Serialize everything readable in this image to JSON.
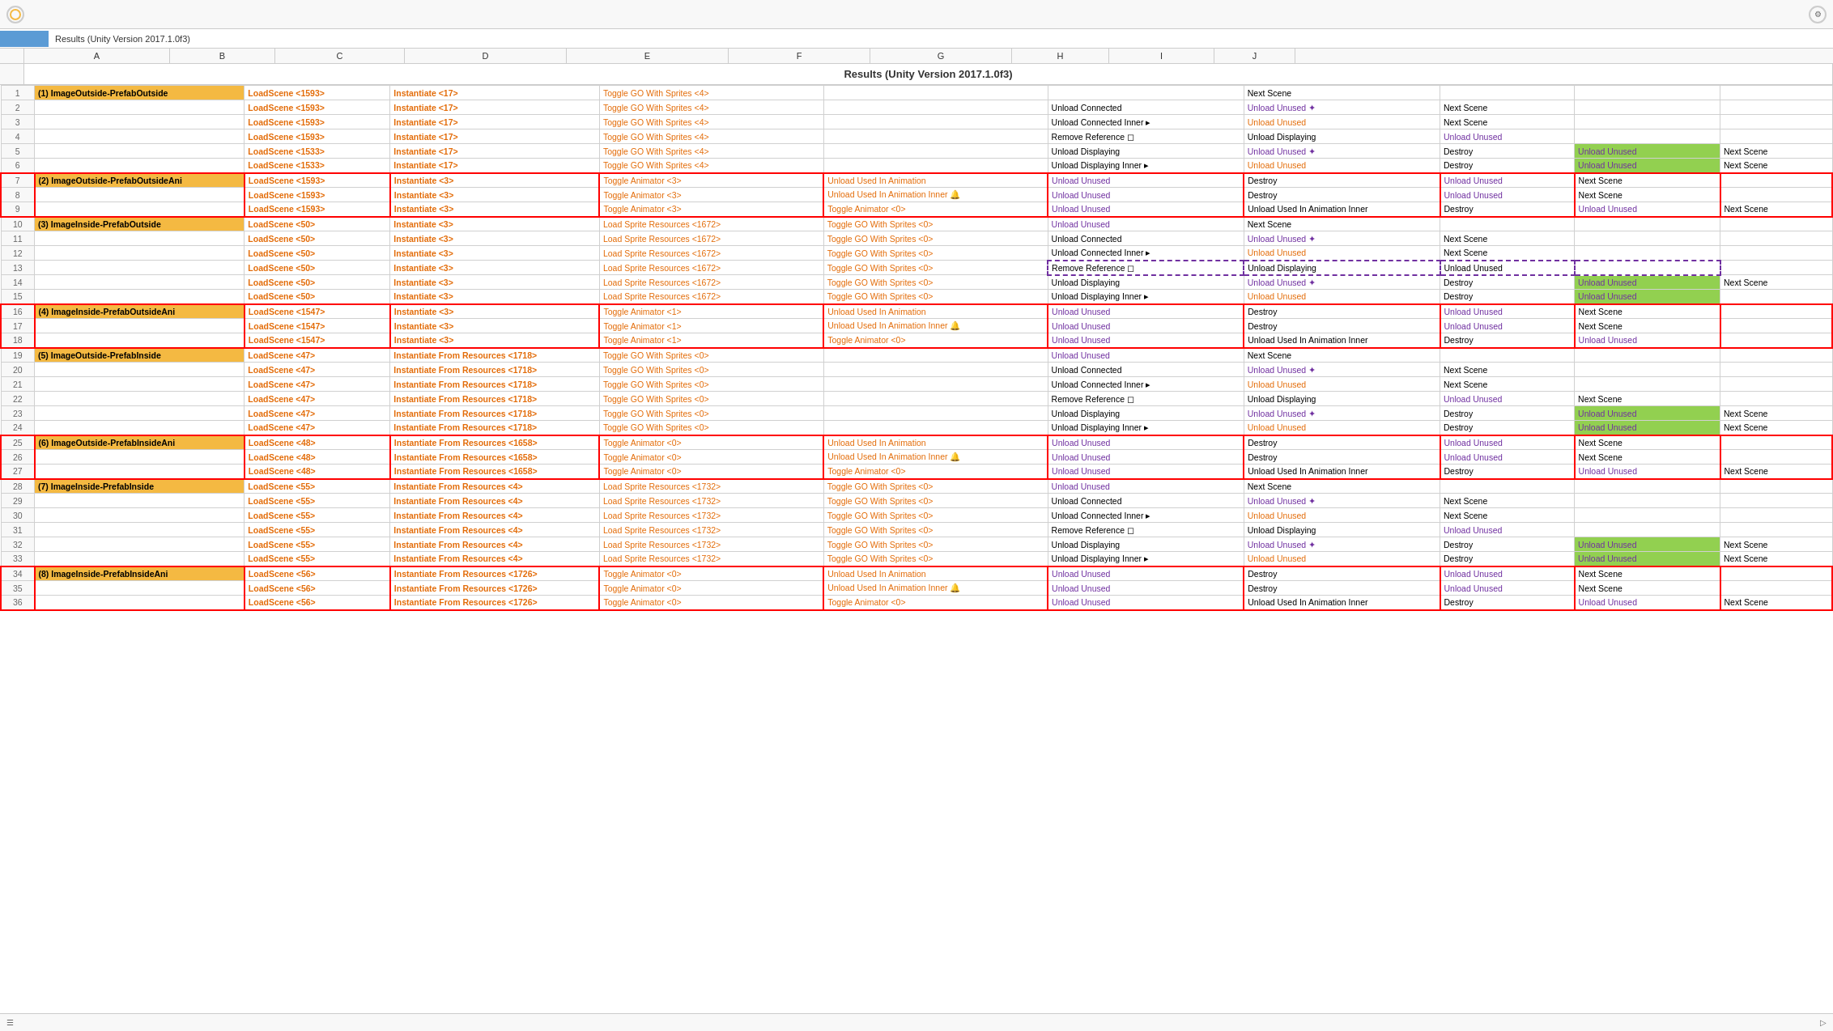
{
  "app": {
    "title": "Results (Unity Version 2017.1.0f3)"
  },
  "columns": {
    "headers": [
      "",
      "A",
      "B",
      "C",
      "D",
      "E",
      "F",
      "G",
      "H",
      "I",
      "J"
    ],
    "widths": [
      30,
      180,
      130,
      160,
      200,
      200,
      175,
      175,
      120,
      130,
      100
    ]
  },
  "rows": [
    {
      "num": "1",
      "a": "(1) ImageOutside-PrefabOutside",
      "b": "LoadScene <1593>",
      "c": "Instantiate <17>",
      "d": "Toggle GO With Sprites <4>",
      "e": "",
      "f": "",
      "g": "Next Scene",
      "h": "",
      "i": "",
      "j": "",
      "a_class": "orange-bg section-header"
    },
    {
      "num": "2",
      "a": "",
      "b": "LoadScene <1593>",
      "c": "Instantiate <17>",
      "d": "Toggle GO With Sprites <4>",
      "e": "",
      "f": "Unload Connected",
      "g": "Unload Unused ✦",
      "h": "Next Scene",
      "i": "",
      "j": "",
      "g_class": "purple-text"
    },
    {
      "num": "3",
      "a": "",
      "b": "LoadScene <1593>",
      "c": "Instantiate <17>",
      "d": "Toggle GO With Sprites <4>",
      "e": "",
      "f": "Unload Connected Inner ▸",
      "g": "Unload Unused",
      "h": "Next Scene",
      "i": "",
      "j": "",
      "g_class": "orange-text"
    },
    {
      "num": "4",
      "a": "",
      "b": "LoadScene <1593>",
      "c": "Instantiate <17>",
      "d": "Toggle GO With Sprites <4>",
      "e": "",
      "f": "Remove Reference ◻",
      "g": "Unload Displaying",
      "h": "Unload Unused",
      "i": "",
      "j": "",
      "h_class": "purple-text"
    },
    {
      "num": "5",
      "a": "",
      "b": "LoadScene <1533>",
      "c": "Instantiate <17>",
      "d": "Toggle GO With Sprites <4>",
      "e": "",
      "f": "Unload Displaying",
      "g": "Unload Unused ✦",
      "h": "Destroy",
      "i": "Unload Unused",
      "j": "Next Scene",
      "g_class": "purple-text",
      "i_class": "green-bg purple-text"
    },
    {
      "num": "6",
      "a": "",
      "b": "LoadScene <1533>",
      "c": "Instantiate <17>",
      "d": "Toggle GO With Sprites <4>",
      "e": "",
      "f": "Unload Displaying Inner ▸",
      "g": "Unload Unused",
      "h": "Destroy",
      "i": "Unload Unused",
      "j": "Next Scene",
      "g_class": "orange-text",
      "i_class": "green-bg purple-text"
    },
    {
      "num": "7",
      "a": "(2) ImageOutside-PrefabOutsideAni",
      "b": "LoadScene <1593>",
      "c": "Instantiate <3>",
      "d": "Toggle Animator <3>",
      "e": "Unload Used In Animation",
      "f": "Unload Unused",
      "g": "Destroy",
      "h": "Unload Unused",
      "i": "Next Scene",
      "j": "",
      "a_class": "orange-bg section-header",
      "f_class": "purple-text",
      "h_class": "purple-text",
      "red_border": true
    },
    {
      "num": "8",
      "a": "",
      "b": "LoadScene <1593>",
      "c": "Instantiate <3>",
      "d": "Toggle Animator <3>",
      "e": "Unload Used In Animation Inner 🔔",
      "f": "Unload Unused",
      "g": "Destroy",
      "h": "Unload Unused",
      "i": "Next Scene",
      "j": "",
      "f_class": "purple-text",
      "h_class": "purple-text",
      "red_border": true
    },
    {
      "num": "9",
      "a": "",
      "b": "LoadScene <1593>",
      "c": "Instantiate <3>",
      "d": "Toggle Animator <3>",
      "e": "Toggle Animator <0>",
      "f": "Unload Unused",
      "g": "Unload Used In Animation Inner",
      "h": "Destroy",
      "i": "Unload Unused",
      "j": "Next Scene",
      "f_class": "purple-text",
      "i_class": "purple-text",
      "red_border": true
    },
    {
      "num": "10",
      "a": "(3) ImageInside-PrefabOutside",
      "b": "LoadScene <50>",
      "c": "Instantiate <3>",
      "d": "Load Sprite Resources <1672>",
      "e": "Toggle GO With Sprites <0>",
      "f": "Unload Unused",
      "g": "Next Scene",
      "h": "",
      "i": "",
      "j": "",
      "a_class": "orange-bg section-header",
      "f_class": "purple-text"
    },
    {
      "num": "11",
      "a": "",
      "b": "LoadScene <50>",
      "c": "Instantiate <3>",
      "d": "Load Sprite Resources <1672>",
      "e": "Toggle GO With Sprites <0>",
      "f": "Unload Connected",
      "g": "Unload Unused ✦",
      "h": "Next Scene",
      "i": "",
      "j": "",
      "g_class": "purple-text"
    },
    {
      "num": "12",
      "a": "",
      "b": "LoadScene <50>",
      "c": "Instantiate <3>",
      "d": "Load Sprite Resources <1672>",
      "e": "Toggle GO With Sprites <0>",
      "f": "Unload Connected Inner ▸",
      "g": "Unload Unused",
      "h": "Next Scene",
      "i": "",
      "j": "",
      "g_class": "orange-text"
    },
    {
      "num": "13",
      "a": "",
      "b": "LoadScene <50>",
      "c": "Instantiate <3>",
      "d": "Load Sprite Resources <1672>",
      "e": "Toggle GO With Sprites <0>",
      "f": "Remove Reference ◻",
      "g": "Unload Displaying",
      "h": "Unload Unused",
      "i": "",
      "j": "",
      "dashed_purple": true
    },
    {
      "num": "14",
      "a": "",
      "b": "LoadScene <50>",
      "c": "Instantiate <3>",
      "d": "Load Sprite Resources <1672>",
      "e": "Toggle GO With Sprites <0>",
      "f": "Unload Displaying",
      "g": "Unload Unused ✦",
      "h": "Destroy",
      "i": "Unload Unused",
      "j": "Next Scene",
      "g_class": "purple-text",
      "i_class": "green-bg purple-text"
    },
    {
      "num": "15",
      "a": "",
      "b": "LoadScene <50>",
      "c": "Instantiate <3>",
      "d": "Load Sprite Resources <1672>",
      "e": "Toggle GO With Sprites <0>",
      "f": "Unload Displaying Inner ▸",
      "g": "Unload Unused",
      "h": "Destroy",
      "i": "Unload Unused",
      "j": "",
      "g_class": "orange-text",
      "i_class": "green-bg purple-text"
    },
    {
      "num": "16",
      "a": "(4) ImageInside-PrefabOutsideAni",
      "b": "LoadScene <1547>",
      "c": "Instantiate <3>",
      "d": "Toggle Animator <1>",
      "e": "Unload Used In Animation",
      "f": "Unload Unused",
      "g": "Destroy",
      "h": "Unload Unused",
      "i": "Next Scene",
      "j": "",
      "a_class": "orange-bg section-header",
      "f_class": "purple-text",
      "h_class": "purple-text",
      "red_border": true
    },
    {
      "num": "17",
      "a": "",
      "b": "LoadScene <1547>",
      "c": "Instantiate <3>",
      "d": "Toggle Animator <1>",
      "e": "Unload Used In Animation Inner 🔔",
      "f": "Unload Unused",
      "g": "Destroy",
      "h": "Unload Unused",
      "i": "Next Scene",
      "j": "",
      "f_class": "purple-text",
      "h_class": "purple-text",
      "red_border": true
    },
    {
      "num": "18",
      "a": "",
      "b": "LoadScene <1547>",
      "c": "Instantiate <3>",
      "d": "Toggle Animator <1>",
      "e": "Toggle Animator <0>",
      "f": "Unload Unused",
      "g": "Unload Used In Animation Inner",
      "h": "Destroy",
      "i": "Unload Unused",
      "j": "",
      "f_class": "purple-text",
      "i_class": "purple-text",
      "red_border": true
    },
    {
      "num": "19",
      "a": "(5) ImageOutside-PrefabInside",
      "b": "LoadScene <47>",
      "c": "Instantiate From Resources <1718>",
      "d": "Toggle GO With Sprites <0>",
      "e": "",
      "f": "Unload Unused",
      "g": "Next Scene",
      "h": "",
      "i": "",
      "j": "",
      "a_class": "orange-bg section-header",
      "f_class": "purple-text"
    },
    {
      "num": "20",
      "a": "",
      "b": "LoadScene <47>",
      "c": "Instantiate From Resources <1718>",
      "d": "Toggle GO With Sprites <0>",
      "e": "",
      "f": "Unload Connected",
      "g": "Unload Unused ✦",
      "h": "Next Scene",
      "i": "",
      "j": "",
      "g_class": "purple-text"
    },
    {
      "num": "21",
      "a": "",
      "b": "LoadScene <47>",
      "c": "Instantiate From Resources <1718>",
      "d": "Toggle GO With Sprites <0>",
      "e": "",
      "f": "Unload Connected Inner ▸",
      "g": "Unload Unused",
      "h": "Next Scene",
      "i": "",
      "j": "",
      "g_class": "orange-text"
    },
    {
      "num": "22",
      "a": "",
      "b": "LoadScene <47>",
      "c": "Instantiate From Resources <1718>",
      "d": "Toggle GO With Sprites <0>",
      "e": "",
      "f": "Remove Reference ◻",
      "g": "Unload Displaying",
      "h": "Unload Unused",
      "i": "Next Scene",
      "j": "",
      "h_class": "purple-text"
    },
    {
      "num": "23",
      "a": "",
      "b": "LoadScene <47>",
      "c": "Instantiate From Resources <1718>",
      "d": "Toggle GO With Sprites <0>",
      "e": "",
      "f": "Unload Displaying",
      "g": "Unload Unused ✦",
      "h": "Destroy",
      "i": "Unload Unused",
      "j": "Next Scene",
      "g_class": "purple-text",
      "i_class": "green-bg purple-text"
    },
    {
      "num": "24",
      "a": "",
      "b": "LoadScene <47>",
      "c": "Instantiate From Resources <1718>",
      "d": "Toggle GO With Sprites <0>",
      "e": "",
      "f": "Unload Displaying Inner ▸",
      "g": "Unload Unused",
      "h": "Destroy",
      "i": "Unload Unused",
      "j": "Next Scene",
      "g_class": "orange-text",
      "i_class": "green-bg purple-text"
    },
    {
      "num": "25",
      "a": "(6) ImageOutside-PrefabInsideAni",
      "b": "LoadScene <48>",
      "c": "Instantiate From Resources <1658>",
      "d": "Toggle Animator <0>",
      "e": "Unload Used In Animation",
      "f": "Unload Unused",
      "g": "Destroy",
      "h": "Unload Unused",
      "i": "Next Scene",
      "j": "",
      "a_class": "orange-bg section-header",
      "f_class": "purple-text",
      "h_class": "purple-text",
      "red_border": true
    },
    {
      "num": "26",
      "a": "",
      "b": "LoadScene <48>",
      "c": "Instantiate From Resources <1658>",
      "d": "Toggle Animator <0>",
      "e": "Unload Used In Animation Inner 🔔",
      "f": "Unload Unused",
      "g": "Destroy",
      "h": "Unload Unused",
      "i": "Next Scene",
      "j": "",
      "f_class": "purple-text",
      "h_class": "purple-text",
      "red_border": true
    },
    {
      "num": "27",
      "a": "",
      "b": "LoadScene <48>",
      "c": "Instantiate From Resources <1658>",
      "d": "Toggle Animator <0>",
      "e": "Toggle Animator <0>",
      "f": "Unload Unused",
      "g": "Unload Used In Animation Inner",
      "h": "Destroy",
      "i": "Unload Unused",
      "j": "Next Scene",
      "f_class": "purple-text",
      "i_class": "purple-text",
      "red_border": true
    },
    {
      "num": "28",
      "a": "(7) ImageInside-PrefabInside",
      "b": "LoadScene <55>",
      "c": "Instantiate From Resources <4>",
      "d": "Load Sprite Resources <1732>",
      "e": "Toggle GO With Sprites <0>",
      "f": "Unload Unused",
      "g": "Next Scene",
      "h": "",
      "i": "",
      "j": "",
      "a_class": "orange-bg section-header",
      "f_class": "purple-text"
    },
    {
      "num": "29",
      "a": "",
      "b": "LoadScene <55>",
      "c": "Instantiate From Resources <4>",
      "d": "Load Sprite Resources <1732>",
      "e": "Toggle GO With Sprites <0>",
      "f": "Unload Connected",
      "g": "Unload Unused ✦",
      "h": "Next Scene",
      "i": "",
      "j": "",
      "g_class": "purple-text"
    },
    {
      "num": "30",
      "a": "",
      "b": "LoadScene <55>",
      "c": "Instantiate From Resources <4>",
      "d": "Load Sprite Resources <1732>",
      "e": "Toggle GO With Sprites <0>",
      "f": "Unload Connected Inner ▸",
      "g": "Unload Unused",
      "h": "Next Scene",
      "i": "",
      "j": "",
      "g_class": "orange-text"
    },
    {
      "num": "31",
      "a": "",
      "b": "LoadScene <55>",
      "c": "Instantiate From Resources <4>",
      "d": "Load Sprite Resources <1732>",
      "e": "Toggle GO With Sprites <0>",
      "f": "Remove Reference ◻",
      "g": "Unload Displaying",
      "h": "Unload Unused",
      "i": "",
      "j": "",
      "h_class": "purple-text"
    },
    {
      "num": "32",
      "a": "",
      "b": "LoadScene <55>",
      "c": "Instantiate From Resources <4>",
      "d": "Load Sprite Resources <1732>",
      "e": "Toggle GO With Sprites <0>",
      "f": "Unload Displaying",
      "g": "Unload Unused ✦",
      "h": "Destroy",
      "i": "Unload Unused",
      "j": "Next Scene",
      "g_class": "purple-text",
      "i_class": "green-bg purple-text"
    },
    {
      "num": "33",
      "a": "",
      "b": "LoadScene <55>",
      "c": "Instantiate From Resources <4>",
      "d": "Load Sprite Resources <1732>",
      "e": "Toggle GO With Sprites <0>",
      "f": "Unload Displaying Inner ▸",
      "g": "Unload Unused",
      "h": "Destroy",
      "i": "Unload Unused",
      "j": "Next Scene",
      "g_class": "orange-text",
      "i_class": "green-bg purple-text"
    },
    {
      "num": "34",
      "a": "(8) ImageInside-PrefabInsideAni",
      "b": "LoadScene <56>",
      "c": "Instantiate From Resources <1726>",
      "d": "Toggle Animator <0>",
      "e": "Unload Used In Animation",
      "f": "Unload Unused",
      "g": "Destroy",
      "h": "Unload Unused",
      "i": "Next Scene",
      "j": "",
      "a_class": "orange-bg section-header",
      "f_class": "purple-text",
      "h_class": "purple-text",
      "red_border": true
    },
    {
      "num": "35",
      "a": "",
      "b": "LoadScene <56>",
      "c": "Instantiate From Resources <1726>",
      "d": "Toggle Animator <0>",
      "e": "Unload Used In Animation Inner 🔔",
      "f": "Unload Unused",
      "g": "Destroy",
      "h": "Unload Unused",
      "i": "Next Scene",
      "j": "",
      "f_class": "purple-text",
      "h_class": "purple-text",
      "red_border": true
    },
    {
      "num": "36",
      "a": "",
      "b": "LoadScene <56>",
      "c": "Instantiate From Resources <1726>",
      "d": "Toggle Animator <0>",
      "e": "Toggle Animator <0>",
      "f": "Unload Unused",
      "g": "Unload Used In Animation Inner",
      "h": "Destroy",
      "i": "Unload Unused",
      "j": "Next Scene",
      "f_class": "purple-text",
      "i_class": "purple-text",
      "red_border": true
    }
  ]
}
